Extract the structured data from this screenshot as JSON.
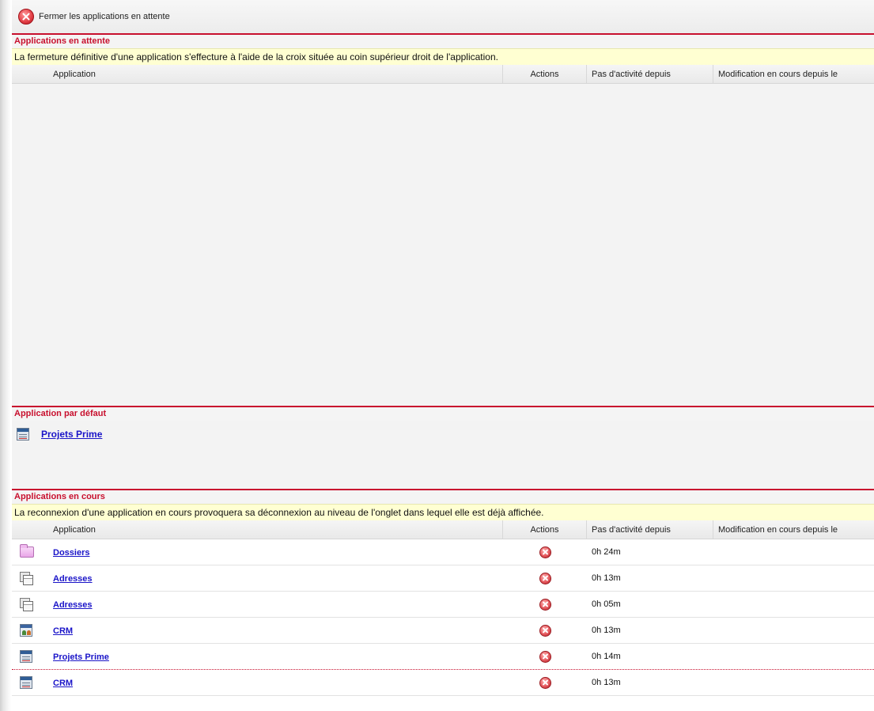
{
  "toolbar": {
    "close_label": "Fermer les applications en attente"
  },
  "pending": {
    "title": "Applications en attente",
    "notice": "La fermeture définitive d'une application s'effecture à l'aide de la croix située au coin supérieur droit de l'application.",
    "headers": {
      "application": "Application",
      "actions": "Actions",
      "inactive": "Pas d'activité depuis",
      "modified": "Modification en cours depuis le"
    }
  },
  "default_app": {
    "title": "Application par défaut",
    "name": "Projets Prime",
    "icon": "window-icon"
  },
  "running": {
    "title": "Applications en cours",
    "notice": "La reconnexion d'une application en cours provoquera sa déconnexion au niveau de l'onglet dans lequel elle est déjà affichée.",
    "headers": {
      "application": "Application",
      "actions": "Actions",
      "inactive": "Pas d'activité depuis",
      "modified": "Modification en cours depuis le"
    },
    "rows": [
      {
        "name": "Dossiers",
        "icon": "folder-icon",
        "inactive": "0h 24m",
        "modified": ""
      },
      {
        "name": "Adresses",
        "icon": "address-cards-icon",
        "inactive": "0h 13m",
        "modified": ""
      },
      {
        "name": "Adresses",
        "icon": "address-cards-icon",
        "inactive": "0h 05m",
        "modified": ""
      },
      {
        "name": "CRM",
        "icon": "crm-icon",
        "inactive": "0h 13m",
        "modified": ""
      },
      {
        "name": "Projets Prime",
        "icon": "window-icon",
        "inactive": "0h 14m",
        "modified": ""
      },
      {
        "name": "CRM",
        "icon": "window-icon",
        "inactive": "0h 13m",
        "modified": ""
      }
    ]
  },
  "colors": {
    "accent_red": "#c8102e",
    "notice_yellow": "#ffffd2",
    "link_blue": "#1a14c8"
  }
}
